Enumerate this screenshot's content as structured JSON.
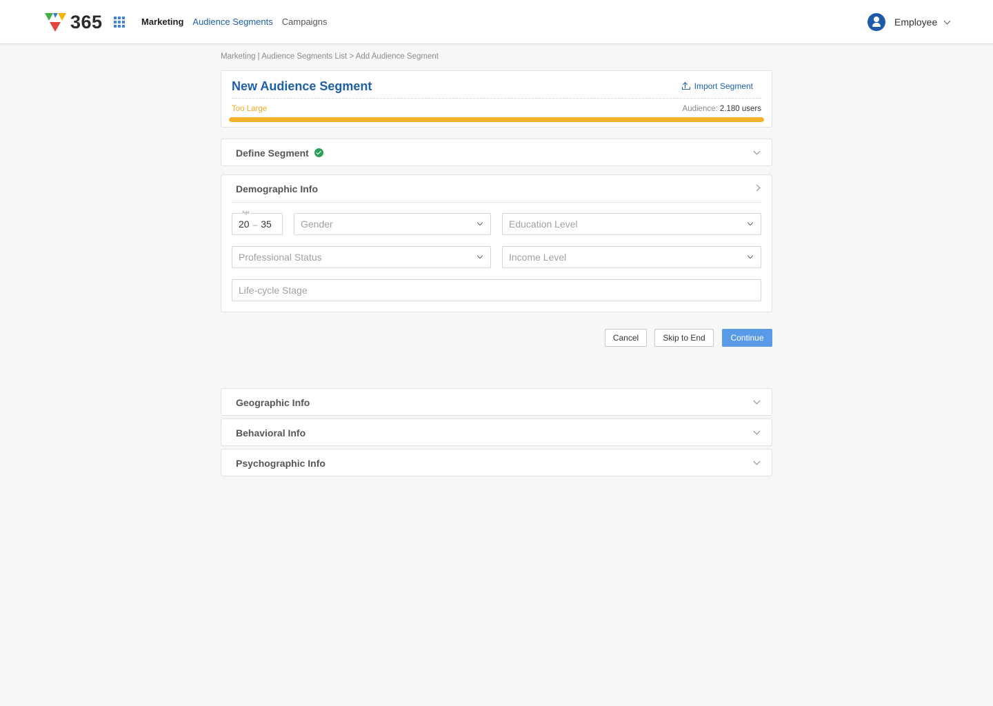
{
  "app": {
    "logo_text": "365",
    "nav": [
      "Marketing",
      "Audience Segments",
      "Campaigns"
    ],
    "user_name": "Employee"
  },
  "breadcrumb": "Marketing | Audience Segments List > Add Audience Segment",
  "segment": {
    "title": "New Audience Segment",
    "import_label": "Import Segment",
    "size_status": "Too Large",
    "audience_label": "Audience:",
    "audience_value": "2.180",
    "audience_unit": "users",
    "progress_fraction": 1.0,
    "status_color": "#f5b02b"
  },
  "sections": {
    "define": "Define Segment",
    "demographic": "Demographic Info",
    "geographic": "Geographic Info",
    "behavioral": "Behavioral Info",
    "psychographic": "Psychographic Info"
  },
  "demographic": {
    "age_label": "Age",
    "age_min": "20",
    "age_dash": "–",
    "age_max": "35",
    "gender_placeholder": "Gender",
    "education_placeholder": "Education Level",
    "professional_placeholder": "Professional Status",
    "income_placeholder": "Income Level",
    "lifecycle_placeholder": "Life-cycle Stage"
  },
  "actions": {
    "cancel": "Cancel",
    "skip": "Skip to End",
    "continue": "Continue"
  },
  "colors": {
    "accent": "#1d5fa8",
    "primary_button": "#5a9be8",
    "success": "#2aa05a",
    "warning": "#f5a623"
  }
}
